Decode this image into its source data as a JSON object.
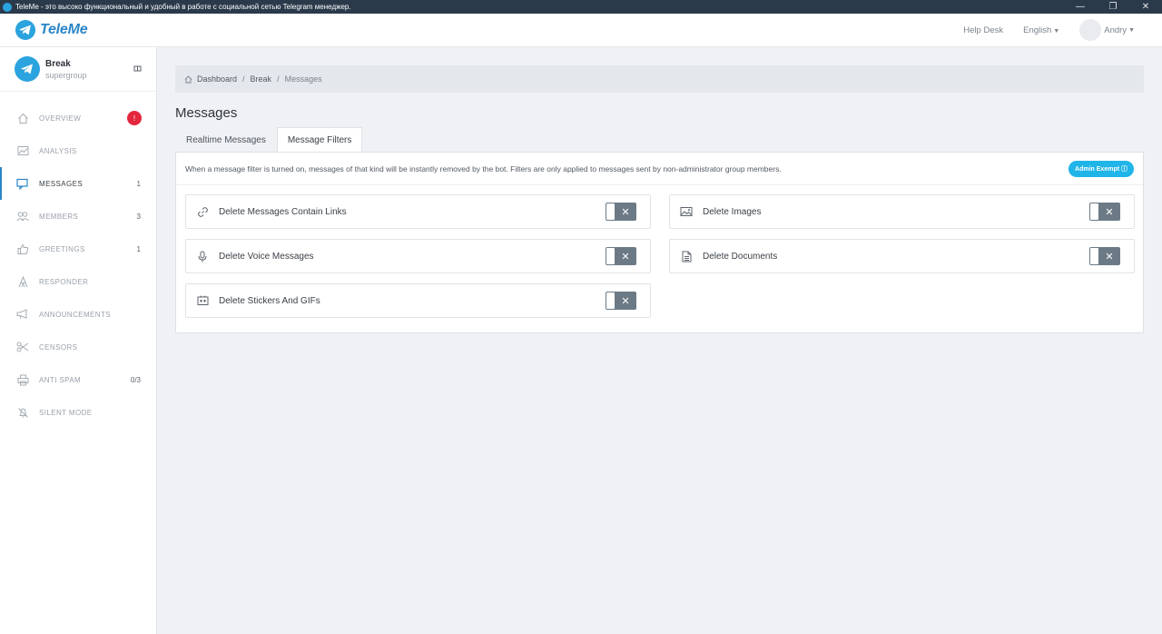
{
  "window": {
    "title": "TeleMe - это высоко функциональный и удобный в работе с социальной сетью Telegram менеджер.",
    "controls": [
      "—",
      "❐",
      "✕"
    ]
  },
  "header": {
    "logo_text": "TeleMe",
    "help_desk": "Help Desk",
    "language": "English",
    "user_name": "Andry"
  },
  "sidebar": {
    "group_name": "Break",
    "group_type": "supergroup",
    "items": [
      {
        "label": "OVERVIEW",
        "icon": "home-icon",
        "badge": "!"
      },
      {
        "label": "ANALYSIS",
        "icon": "chart-icon",
        "count": ""
      },
      {
        "label": "MESSAGES",
        "icon": "chat-icon",
        "count": "1",
        "active": true
      },
      {
        "label": "MEMBERS",
        "icon": "users-icon",
        "count": "3"
      },
      {
        "label": "GREETINGS",
        "icon": "thumbs-up-icon",
        "count": "1"
      },
      {
        "label": "RESPONDER",
        "icon": "responder-icon",
        "count": ""
      },
      {
        "label": "ANNOUNCEMENTS",
        "icon": "megaphone-icon",
        "count": ""
      },
      {
        "label": "CENSORS",
        "icon": "scissors-icon",
        "count": ""
      },
      {
        "label": "ANTI SPAM",
        "icon": "printer-icon",
        "count": "0/3"
      },
      {
        "label": "SILENT MODE",
        "icon": "mute-icon",
        "count": ""
      }
    ]
  },
  "breadcrumb": [
    "Dashboard",
    "Break",
    "Messages"
  ],
  "page_title": "Messages",
  "tabs": [
    {
      "label": "Realtime Messages"
    },
    {
      "label": "Message Filters",
      "active": true
    }
  ],
  "panel": {
    "description": "When a message filter is turned on, messages of that kind will be instantly removed by the bot. Filters are only applied to messages sent by non-administrator group members.",
    "admin_exempt": "Admin Exempt ⓘ"
  },
  "filters": [
    {
      "label": "Delete Messages Contain Links",
      "icon": "link-icon",
      "enabled": false
    },
    {
      "label": "Delete Images",
      "icon": "image-icon",
      "enabled": false
    },
    {
      "label": "Delete Voice Messages",
      "icon": "microphone-icon",
      "enabled": false
    },
    {
      "label": "Delete Documents",
      "icon": "document-icon",
      "enabled": false
    },
    {
      "label": "Delete Stickers And GIFs",
      "icon": "sticker-icon",
      "enabled": false
    }
  ],
  "toggle_off_symbol": "✕",
  "colors": {
    "accent": "#2a86c8",
    "badge_red": "#e4263d",
    "pill_blue": "#20b5e8",
    "toggle_gray": "#6c7a86"
  }
}
